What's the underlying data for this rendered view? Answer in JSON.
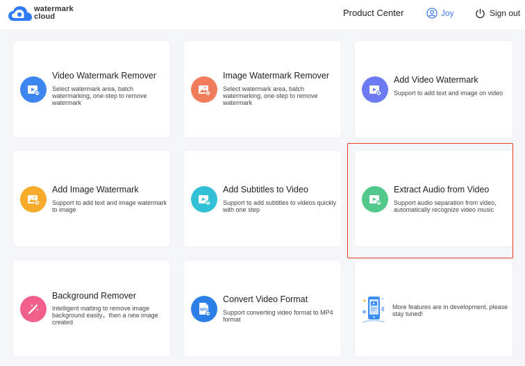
{
  "header": {
    "logo_line1": "watermark",
    "logo_line2": "cloud",
    "product_center": "Product Center",
    "user_name": "Joy",
    "sign_out": "Sign out"
  },
  "cards": [
    {
      "title": "Video Watermark Remover",
      "desc": "Select watermark area, batch watermarking, one-step to remove watermark",
      "icon": "video-remove-icon",
      "color": "#3d86f0"
    },
    {
      "title": "Image Watermark Remover",
      "desc": "Select watermark area, batch watermarking, one-step to remove watermark",
      "icon": "image-remove-icon",
      "color": "#f07c5b"
    },
    {
      "title": "Add Video Watermark",
      "desc": "Support to add text and image on video",
      "icon": "video-add-icon",
      "color": "#6c7bf2"
    },
    {
      "title": "Add Image Watermark",
      "desc": "Support to add text and image watermark to image",
      "icon": "image-add-icon",
      "color": "#f6ab2a"
    },
    {
      "title": "Add Subtitles to Video",
      "desc": "Support to add subtitles to videos quickly with one step",
      "icon": "subtitles-icon",
      "color": "#31c0d6"
    },
    {
      "title": "Extract Audio from Video",
      "desc": "Support audio separation from video, automatically recognize video music",
      "icon": "audio-extract-icon",
      "color": "#52c98a"
    },
    {
      "title": "Background Remover",
      "desc": "Intelligent matting to remove image background easily，then a new image created",
      "icon": "magic-wand-icon",
      "color": "#f0608a"
    },
    {
      "title": "Convert Video Format",
      "desc": "Support converting video format to MP4 format",
      "icon": "mp4-file-icon",
      "color": "#2d7fe8"
    },
    {
      "title": "",
      "desc": "More features are in development, please stay tuned!",
      "icon": "phone-illustration-icon",
      "color": "#3a8ef2"
    }
  ],
  "mp4_label": "MP4"
}
